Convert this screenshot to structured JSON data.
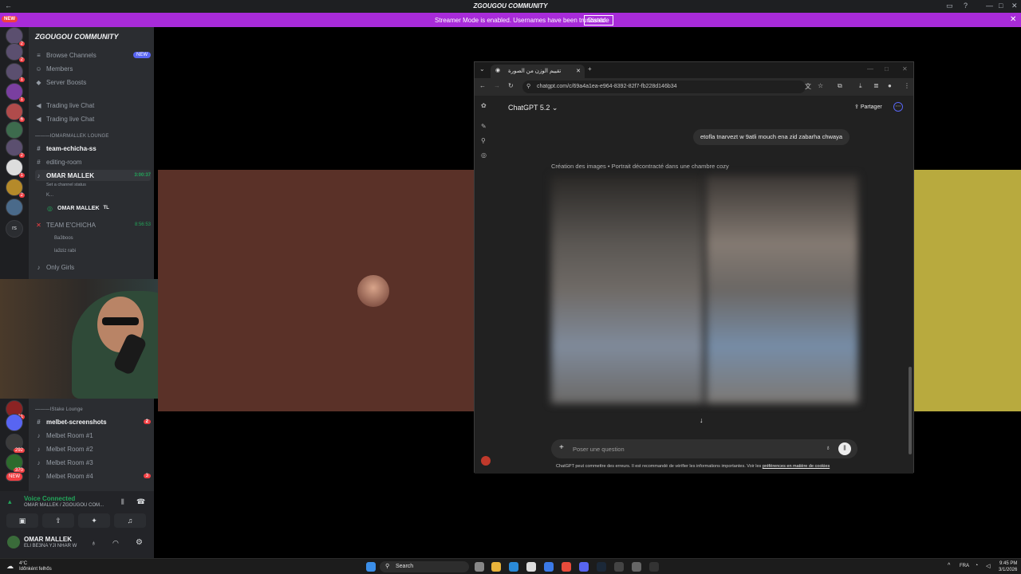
{
  "window": {
    "title": "ZGOUGOU COMMUNITY"
  },
  "banner": {
    "text": "Streamer Mode is enabled. Usernames have been truncated.",
    "button": "Disable",
    "new_badge": "NEW"
  },
  "guild": {
    "name": "ZGOUGOU COMMUNITY"
  },
  "sidebar": {
    "top": [
      {
        "label": "Browse Channels",
        "tag": "NEW"
      },
      {
        "label": "Members"
      },
      {
        "label": "Server Boosts"
      }
    ],
    "chat": [
      "Trading live Chat",
      "Trading live Chat"
    ],
    "cat_lounge": "———IOMARMALLEK LOUNGE",
    "lounge": [
      {
        "label": "team-echicha-ss"
      },
      {
        "label": "editing-room"
      },
      {
        "label": "OMAR MALLEK",
        "time": "3:00:37",
        "status": "Set a channel status"
      },
      {
        "label": "K..."
      },
      {
        "label": "OMAR MALLEK",
        "badge": "TL"
      },
      {
        "label": "TEAM E'CHICHA",
        "time": "8:56:53"
      },
      {
        "label": "Ba3boos"
      },
      {
        "label": "la3ziz rabi"
      },
      {
        "label": "Only Girls"
      }
    ],
    "cat_stake": "———IStake Lounge",
    "stake": [
      {
        "label": "melbet-screenshots",
        "count": "2"
      },
      {
        "label": "Melbet Room #1"
      },
      {
        "label": "Melbet Room #2"
      },
      {
        "label": "Melbet Room #3"
      },
      {
        "label": "Melbet Room #4",
        "count": "3"
      }
    ]
  },
  "voice": {
    "status": "Voice Connected",
    "channel": "OMAR MALLEK / ZGOUGOU COM...",
    "username": "OMAR MALLEK",
    "user_status": "ELI BE3NA YJI NHAR W"
  },
  "browser": {
    "tab_title": "تقييم الوزن من الصورة",
    "url": "chatgpt.com/c/69a4a1ea-e964-8392-82f7-fb228d146b34",
    "model": "ChatGPT 5.2",
    "share": "Partager",
    "user_message": "etofla tnarvezt w 9atli mouch ena zid zabarha chwaya",
    "images_caption": "Création des images • Portrait décontracté dans une chambre cozy",
    "composer_placeholder": "Poser une question",
    "disclaimer": "ChatGPT peut commettre des erreurs. Il est recommandé de vérifier les informations importantes. Voir les",
    "disclaimer_link": "préférences en matière de cookies"
  },
  "taskbar": {
    "weather_temp": "4°C",
    "weather_desc": "Időnként felhős",
    "search": "Search",
    "lang": "FRA",
    "time": "9:45 PM",
    "date": "3/1/2026"
  },
  "rail_badges": [
    "2",
    "2",
    "1",
    "1",
    "6",
    "2",
    "1",
    "2",
    "361",
    "292",
    "370",
    "NEW"
  ],
  "colors": {
    "accent": "#a82bd9",
    "online": "#23a55a",
    "danger": "#f23f43"
  }
}
